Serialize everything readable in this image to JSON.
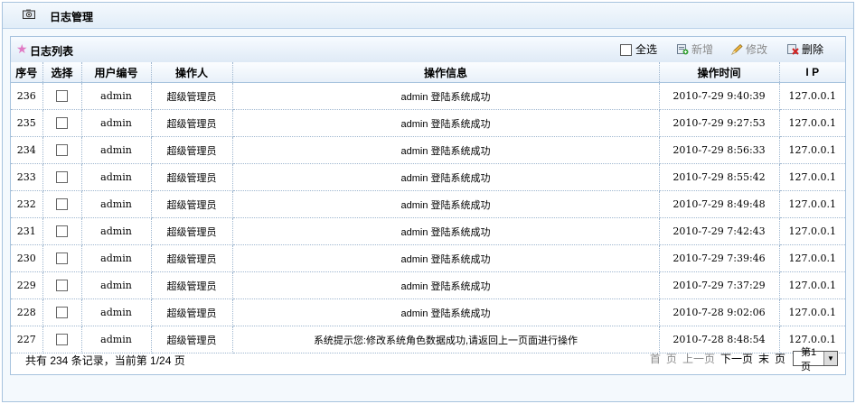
{
  "header": {
    "title": "日志管理",
    "icon": "camera-icon"
  },
  "panel": {
    "title": "日志列表",
    "icon": "star-icon"
  },
  "toolbar": {
    "select_all": "全选",
    "add": "新增",
    "edit": "修改",
    "delete": "删除"
  },
  "columns": [
    "序号",
    "选择",
    "用户编号",
    "操作人",
    "操作信息",
    "操作时间",
    "I P"
  ],
  "rows": [
    {
      "id": "236",
      "user": "admin",
      "operator": "超级管理员",
      "info": "admin 登陆系统成功",
      "time": "2010-7-29 9:40:39",
      "ip": "127.0.0.1"
    },
    {
      "id": "235",
      "user": "admin",
      "operator": "超级管理员",
      "info": "admin 登陆系统成功",
      "time": "2010-7-29 9:27:53",
      "ip": "127.0.0.1"
    },
    {
      "id": "234",
      "user": "admin",
      "operator": "超级管理员",
      "info": "admin 登陆系统成功",
      "time": "2010-7-29 8:56:33",
      "ip": "127.0.0.1"
    },
    {
      "id": "233",
      "user": "admin",
      "operator": "超级管理员",
      "info": "admin 登陆系统成功",
      "time": "2010-7-29 8:55:42",
      "ip": "127.0.0.1"
    },
    {
      "id": "232",
      "user": "admin",
      "operator": "超级管理员",
      "info": "admin 登陆系统成功",
      "time": "2010-7-29 8:49:48",
      "ip": "127.0.0.1"
    },
    {
      "id": "231",
      "user": "admin",
      "operator": "超级管理员",
      "info": "admin 登陆系统成功",
      "time": "2010-7-29 7:42:43",
      "ip": "127.0.0.1"
    },
    {
      "id": "230",
      "user": "admin",
      "operator": "超级管理员",
      "info": "admin 登陆系统成功",
      "time": "2010-7-29 7:39:46",
      "ip": "127.0.0.1"
    },
    {
      "id": "229",
      "user": "admin",
      "operator": "超级管理员",
      "info": "admin 登陆系统成功",
      "time": "2010-7-29 7:37:29",
      "ip": "127.0.0.1"
    },
    {
      "id": "228",
      "user": "admin",
      "operator": "超级管理员",
      "info": "admin 登陆系统成功",
      "time": "2010-7-28 9:02:06",
      "ip": "127.0.0.1"
    },
    {
      "id": "227",
      "user": "admin",
      "operator": "超级管理员",
      "info": "系统提示您:修改系统角色数据成功,请返回上一页面进行操作",
      "time": "2010-7-28 8:48:54",
      "ip": "127.0.0.1"
    }
  ],
  "footer": {
    "info": "共有 234 条记录，当前第 1/24 页",
    "first": "首",
    "page": "页",
    "prev": "上一页",
    "next": "下一页",
    "last": "末",
    "page2": "页",
    "selected": "第1页"
  }
}
